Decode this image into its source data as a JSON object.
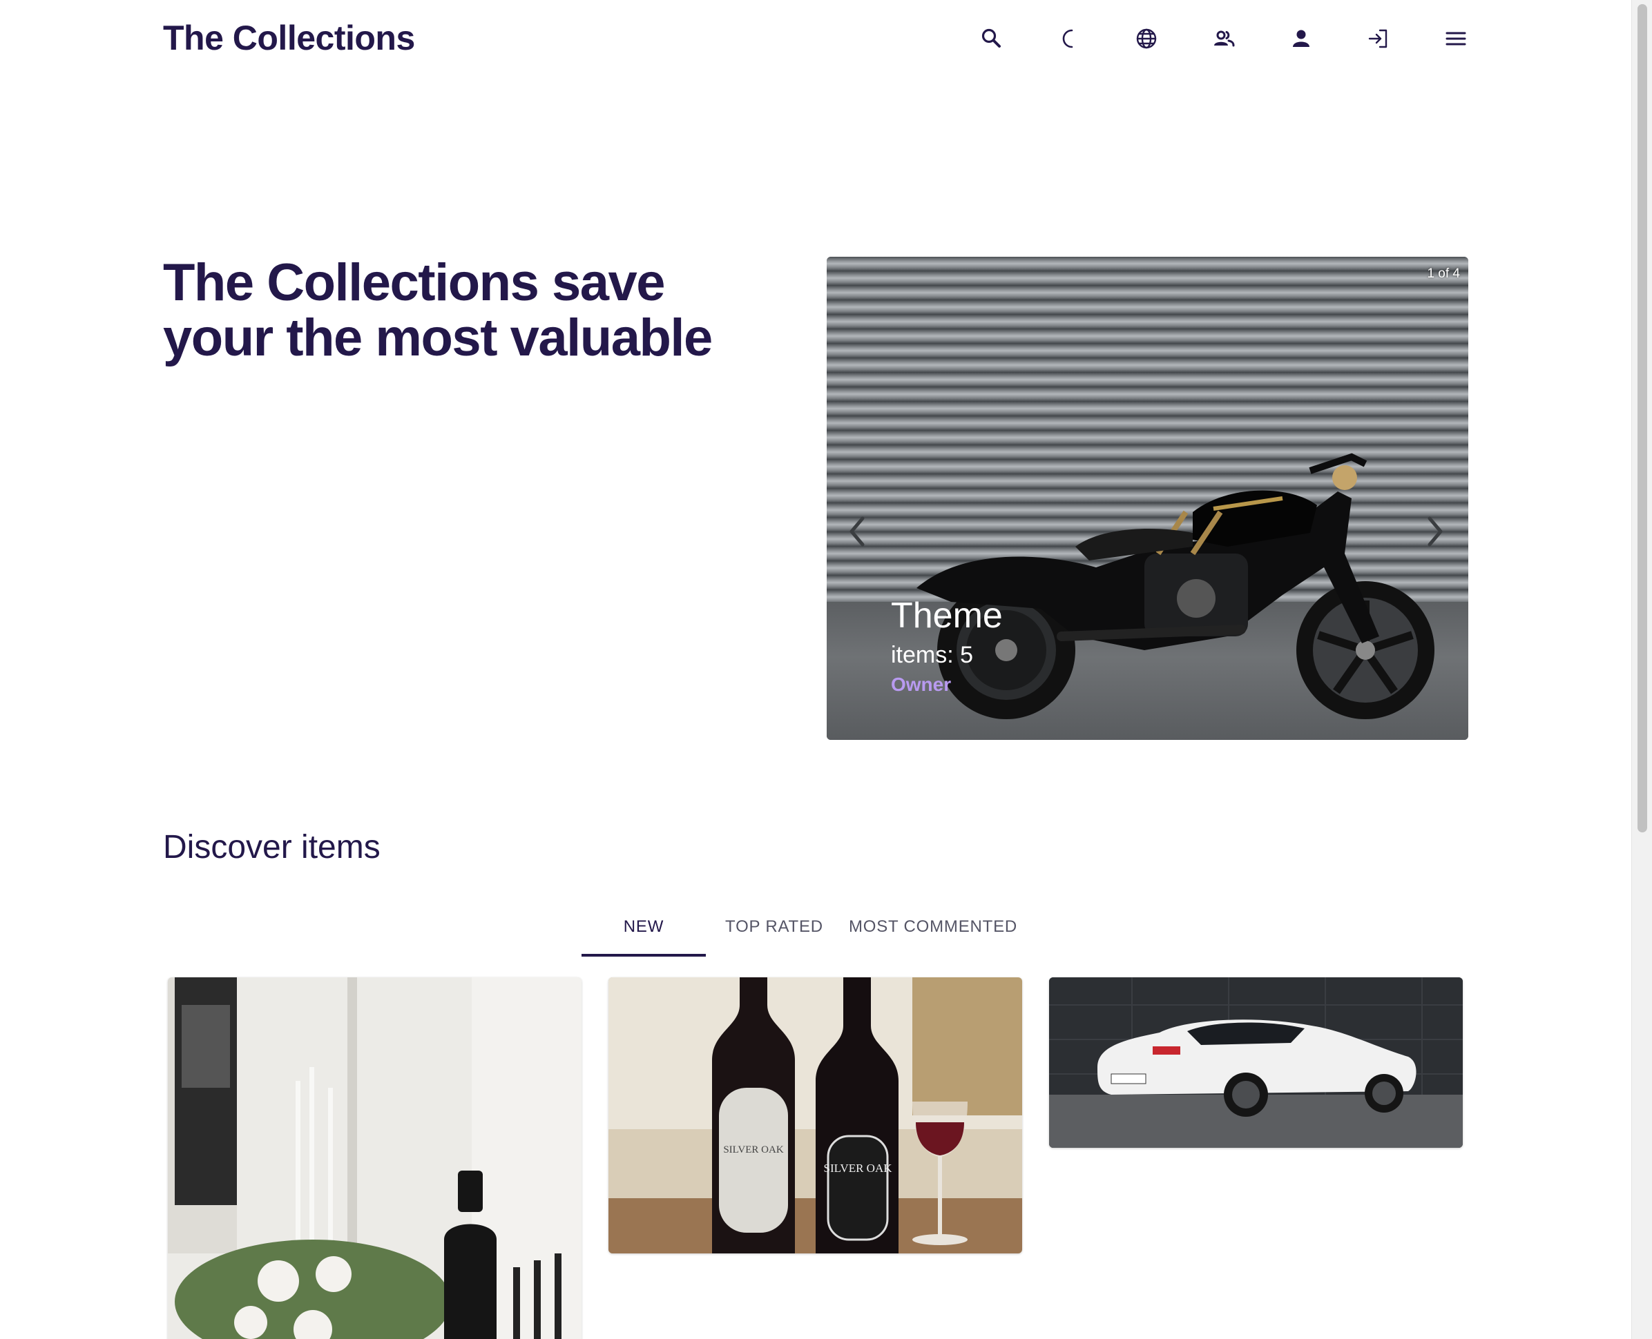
{
  "header": {
    "brand": "The Collections",
    "icons": [
      "search-icon",
      "moon-icon",
      "globe-icon",
      "users-icon",
      "user-icon",
      "login-icon",
      "menu-icon"
    ]
  },
  "hero": {
    "title": "The Collections save your the most valuable",
    "carousel": {
      "counter": "1 of 4",
      "caption_title": "Theme",
      "caption_items": "items: 5",
      "caption_owner": "Owner"
    }
  },
  "discover": {
    "title": "Discover items",
    "tabs": [
      {
        "label": "NEW",
        "active": true
      },
      {
        "label": "TOP RATED",
        "active": false
      },
      {
        "label": "MOST COMMENTED",
        "active": false
      }
    ],
    "cards": [
      {
        "image": "table-with-flowers-and-wine-bottle"
      },
      {
        "image": "two-wine-bottles-and-glass",
        "labels": [
          "SILVER OAK",
          "SILVER OAK"
        ]
      },
      {
        "image": "white-sports-car"
      }
    ]
  },
  "colors": {
    "primary": "#23184a",
    "owner_link": "#b89af0",
    "tab_inactive": "#555566"
  }
}
